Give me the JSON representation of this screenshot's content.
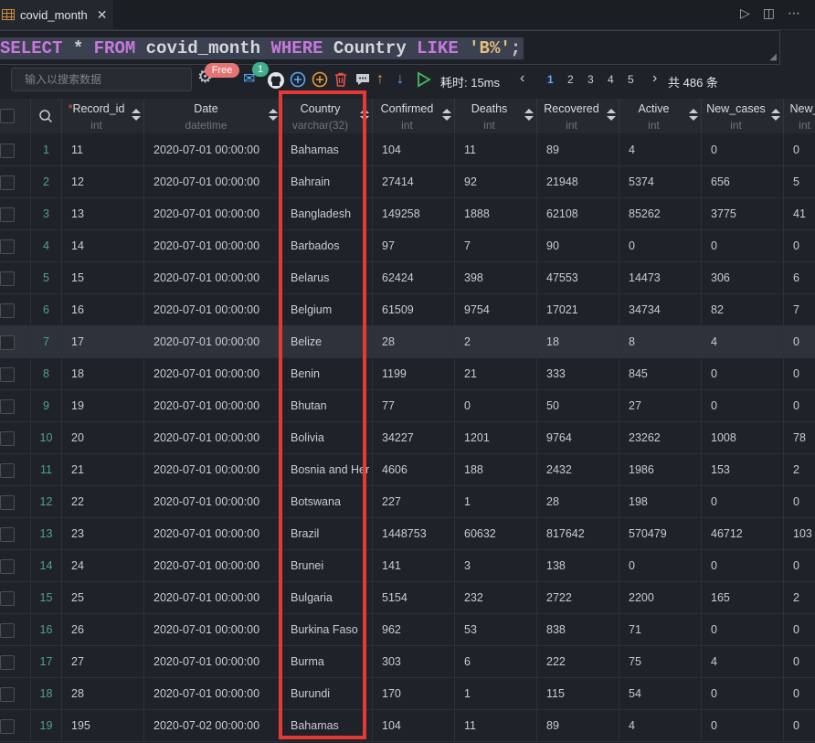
{
  "tab": {
    "title": "covid_month",
    "close": "✕"
  },
  "window_icons": {
    "run": "▷",
    "split": "◫",
    "more": "⋯"
  },
  "sql": {
    "kw_select": "SELECT",
    "star": " * ",
    "kw_from": "FROM",
    "table": " covid_month ",
    "kw_where": "WHERE",
    "col": " Country ",
    "kw_like": "LIKE",
    "pattern": " 'B%'",
    "semi": ";"
  },
  "toolbar": {
    "search_placeholder": "输入以搜索数据",
    "free_badge": "Free",
    "notif_count": "1",
    "timing": "耗时: 15ms",
    "pages": [
      "1",
      "2",
      "3",
      "4",
      "5"
    ],
    "total": "共 486 条",
    "prev": "‹",
    "next": "›"
  },
  "icons": {
    "settings": "gear-icon",
    "mail": "mail-icon",
    "github": "github-icon",
    "add": "add-icon",
    "add_alt": "add-circle-icon",
    "delete": "trash-icon",
    "comment": "comment-icon",
    "up": "arrow-up-icon",
    "down": "arrow-down-icon",
    "run": "play-icon",
    "search": "search-icon"
  },
  "colors": {
    "accent": "#5aa9ff",
    "keyword": "#c678dd",
    "string": "#e5c07b",
    "highlight": "#e53935",
    "rownum": "#4aa58a"
  },
  "columns": [
    {
      "name": "Record_id",
      "type": "int",
      "required": "*"
    },
    {
      "name": "Date",
      "type": "datetime"
    },
    {
      "name": "Country",
      "type": "varchar(32)"
    },
    {
      "name": "Confirmed",
      "type": "int"
    },
    {
      "name": "Deaths",
      "type": "int"
    },
    {
      "name": "Recovered",
      "type": "int"
    },
    {
      "name": "Active",
      "type": "int"
    },
    {
      "name": "New_cases",
      "type": "int"
    },
    {
      "name": "New_",
      "type": "int"
    }
  ],
  "rows": [
    [
      "1",
      "11",
      "2020-07-01 00:00:00",
      "Bahamas",
      "104",
      "11",
      "89",
      "4",
      "0",
      "0"
    ],
    [
      "2",
      "12",
      "2020-07-01 00:00:00",
      "Bahrain",
      "27414",
      "92",
      "21948",
      "5374",
      "656",
      "5"
    ],
    [
      "3",
      "13",
      "2020-07-01 00:00:00",
      "Bangladesh",
      "149258",
      "1888",
      "62108",
      "85262",
      "3775",
      "41"
    ],
    [
      "4",
      "14",
      "2020-07-01 00:00:00",
      "Barbados",
      "97",
      "7",
      "90",
      "0",
      "0",
      "0"
    ],
    [
      "5",
      "15",
      "2020-07-01 00:00:00",
      "Belarus",
      "62424",
      "398",
      "47553",
      "14473",
      "306",
      "6"
    ],
    [
      "6",
      "16",
      "2020-07-01 00:00:00",
      "Belgium",
      "61509",
      "9754",
      "17021",
      "34734",
      "82",
      "7"
    ],
    [
      "7",
      "17",
      "2020-07-01 00:00:00",
      "Belize",
      "28",
      "2",
      "18",
      "8",
      "4",
      "0"
    ],
    [
      "8",
      "18",
      "2020-07-01 00:00:00",
      "Benin",
      "1199",
      "21",
      "333",
      "845",
      "0",
      "0"
    ],
    [
      "9",
      "19",
      "2020-07-01 00:00:00",
      "Bhutan",
      "77",
      "0",
      "50",
      "27",
      "0",
      "0"
    ],
    [
      "10",
      "20",
      "2020-07-01 00:00:00",
      "Bolivia",
      "34227",
      "1201",
      "9764",
      "23262",
      "1008",
      "78"
    ],
    [
      "11",
      "21",
      "2020-07-01 00:00:00",
      "Bosnia and Her",
      "4606",
      "188",
      "2432",
      "1986",
      "153",
      "2"
    ],
    [
      "12",
      "22",
      "2020-07-01 00:00:00",
      "Botswana",
      "227",
      "1",
      "28",
      "198",
      "0",
      "0"
    ],
    [
      "13",
      "23",
      "2020-07-01 00:00:00",
      "Brazil",
      "1448753",
      "60632",
      "817642",
      "570479",
      "46712",
      "103"
    ],
    [
      "14",
      "24",
      "2020-07-01 00:00:00",
      "Brunei",
      "141",
      "3",
      "138",
      "0",
      "0",
      "0"
    ],
    [
      "15",
      "25",
      "2020-07-01 00:00:00",
      "Bulgaria",
      "5154",
      "232",
      "2722",
      "2200",
      "165",
      "2"
    ],
    [
      "16",
      "26",
      "2020-07-01 00:00:00",
      "Burkina Faso",
      "962",
      "53",
      "838",
      "71",
      "0",
      "0"
    ],
    [
      "17",
      "27",
      "2020-07-01 00:00:00",
      "Burma",
      "303",
      "6",
      "222",
      "75",
      "4",
      "0"
    ],
    [
      "18",
      "28",
      "2020-07-01 00:00:00",
      "Burundi",
      "170",
      "1",
      "115",
      "54",
      "0",
      "0"
    ],
    [
      "19",
      "195",
      "2020-07-02 00:00:00",
      "Bahamas",
      "104",
      "11",
      "89",
      "4",
      "0",
      "0"
    ]
  ]
}
